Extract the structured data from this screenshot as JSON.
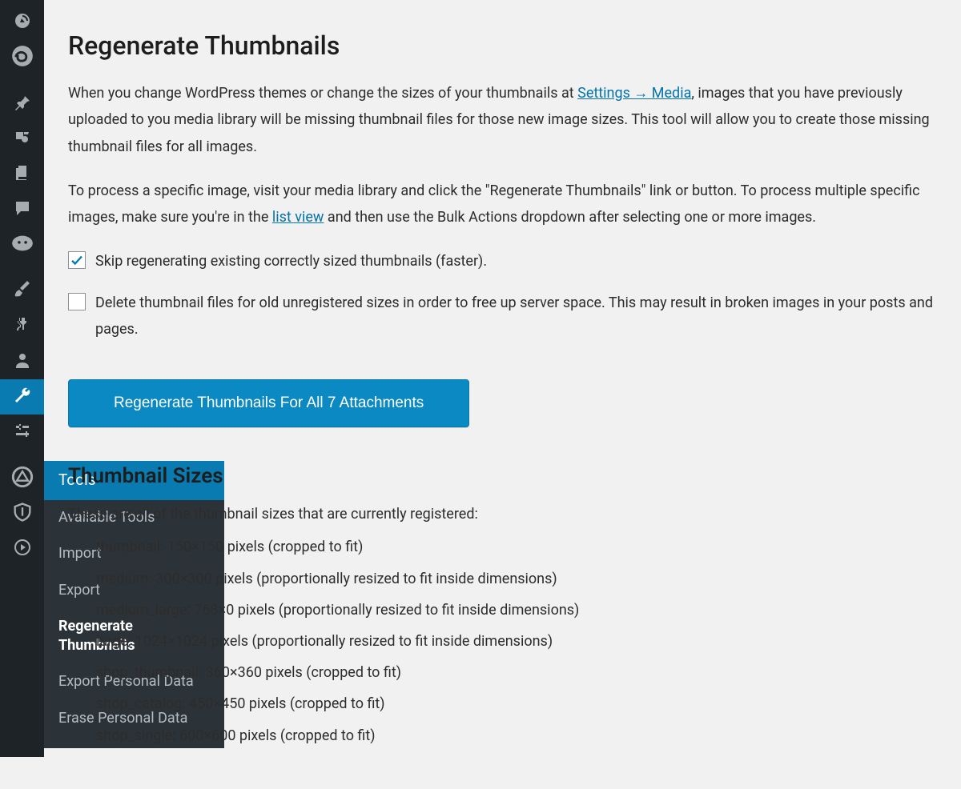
{
  "page": {
    "title": "Regenerate Thumbnails",
    "intro_parts": {
      "a": "When you change WordPress themes or change the sizes of your thumbnails at ",
      "link1": "Settings → Media",
      "b": ", images that you have previously uploaded to you media library will be missing thumbnail files for those new image sizes. This tool will allow you to create those missing thumbnail files for all images."
    },
    "intro2_parts": {
      "a": "To process a specific image, visit your media library and click the \"Regenerate Thumbnails\" link or button. To process multiple specific images, make sure you're in the ",
      "link1": "list view",
      "b": " and then use the Bulk Actions dropdown after selecting one or more images."
    },
    "checkbox1": {
      "checked": true,
      "label": "Skip regenerating existing correctly sized thumbnails (faster)."
    },
    "checkbox2": {
      "checked": false,
      "label": "Delete thumbnail files for old unregistered sizes in order to free up server space. This may result in broken images in your posts and pages."
    },
    "primary_button": "Regenerate Thumbnails For All 7 Attachments",
    "sizes_heading": "Thumbnail Sizes",
    "sizes_intro": "These are all of the thumbnail sizes that are currently registered:",
    "sizes": {
      "s0": "thumbnail: 150×150 pixels (cropped to fit)",
      "s1": "medium: 300×300 pixels (proportionally resized to fit inside dimensions)",
      "s2": "medium_large: 768×0 pixels (proportionally resized to fit inside dimensions)",
      "s3": "large: 1024×1024 pixels (proportionally resized to fit inside dimensions)",
      "s4": "shop_thumbnail: 360×360 pixels (cropped to fit)",
      "s5": "shop_catalog: 450×450 pixels (cropped to fit)",
      "s6": "shop_single: 600×600 pixels (cropped to fit)"
    }
  },
  "sidebar": {
    "tools_label": "Tools",
    "submenu": {
      "available": "Available Tools",
      "import": "Import",
      "export": "Export",
      "regen": "Regenerate Thumbnails",
      "export_personal": "Export Personal Data",
      "erase_personal": "Erase Personal Data"
    }
  }
}
